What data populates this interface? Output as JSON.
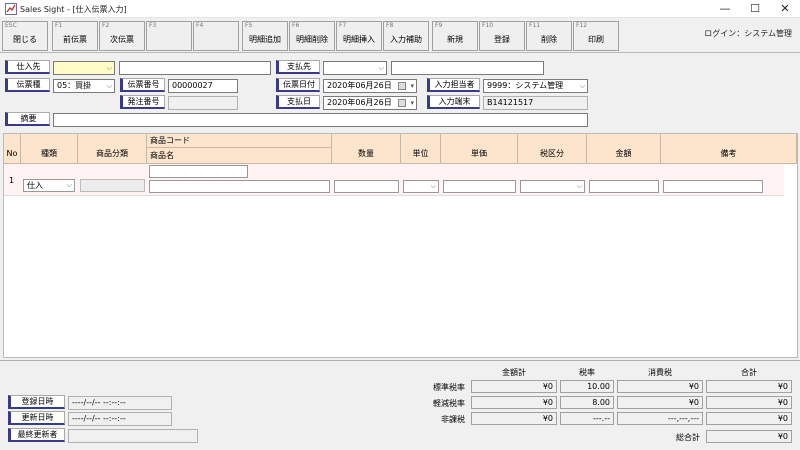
{
  "window": {
    "title": "Sales Sight - [仕入伝票入力]",
    "min_symbol": "—",
    "max_symbol": "☐",
    "close_symbol": "✕"
  },
  "toolbar": {
    "keys": [
      {
        "key": "ESC",
        "label": "閉じる"
      },
      {
        "key": "F1",
        "label": "前伝票"
      },
      {
        "key": "F2",
        "label": "次伝票"
      },
      {
        "key": "F3",
        "label": ""
      },
      {
        "key": "F4",
        "label": ""
      },
      {
        "key": "F5",
        "label": "明細追加"
      },
      {
        "key": "F6",
        "label": "明細削除"
      },
      {
        "key": "F7",
        "label": "明細挿入"
      },
      {
        "key": "F8",
        "label": "入力補助"
      },
      {
        "key": "F9",
        "label": "新規"
      },
      {
        "key": "F10",
        "label": "登録"
      },
      {
        "key": "F11",
        "label": "削除"
      },
      {
        "key": "F12",
        "label": "印刷"
      }
    ],
    "login": "ログイン：システム管理"
  },
  "header": {
    "supplier_label": "仕入先",
    "supplier_code": "",
    "supplier_name": "",
    "payee_label": "支払先",
    "payee_code": "",
    "payee_name": "",
    "slip_type_label": "伝票種",
    "slip_type_value": "05：買掛",
    "slip_no_label": "伝票番号",
    "slip_no_value": "00000027",
    "slip_date_label": "伝票日付",
    "slip_date_value": "2020年06月26日",
    "entry_person_label": "入力担当者",
    "entry_person_value": "9999：システム管理",
    "order_no_label": "発注番号",
    "order_no_value": "",
    "pay_date_label": "支払日",
    "pay_date_value": "2020年06月26日",
    "terminal_label": "入力端末",
    "terminal_value": "B14121517",
    "memo_label": "摘要",
    "memo_value": ""
  },
  "grid": {
    "headers": {
      "no": "No",
      "kind": "種類",
      "category": "商品分類",
      "code": "商品コード",
      "name": "商品名",
      "qty": "数量",
      "unit": "単位",
      "price": "単価",
      "tax": "税区分",
      "amount": "金額",
      "note": "備考"
    },
    "rows": [
      {
        "no": "1",
        "kind": "仕入"
      }
    ]
  },
  "footer": {
    "registered_label": "登録日時",
    "registered_value": "----/--/-- --:--:--",
    "updated_label": "更新日時",
    "updated_value": "----/--/-- --:--:--",
    "last_updater_label": "最終更新者",
    "last_updater_value": "",
    "col_amount": "金額計",
    "col_rate": "税率",
    "col_tax": "消費税",
    "col_total": "合計",
    "rows": [
      {
        "label": "標準税率",
        "amount": "¥0",
        "rate": "10.00",
        "tax": "¥0",
        "total": "¥0"
      },
      {
        "label": "軽減税率",
        "amount": "¥0",
        "rate": "8.00",
        "tax": "¥0",
        "total": "¥0"
      },
      {
        "label": "非課税",
        "amount": "¥0",
        "rate": "---.--",
        "tax": "---,---,---",
        "total": "¥0"
      }
    ],
    "grand_total_label": "総合計",
    "grand_total_value": "¥0"
  }
}
